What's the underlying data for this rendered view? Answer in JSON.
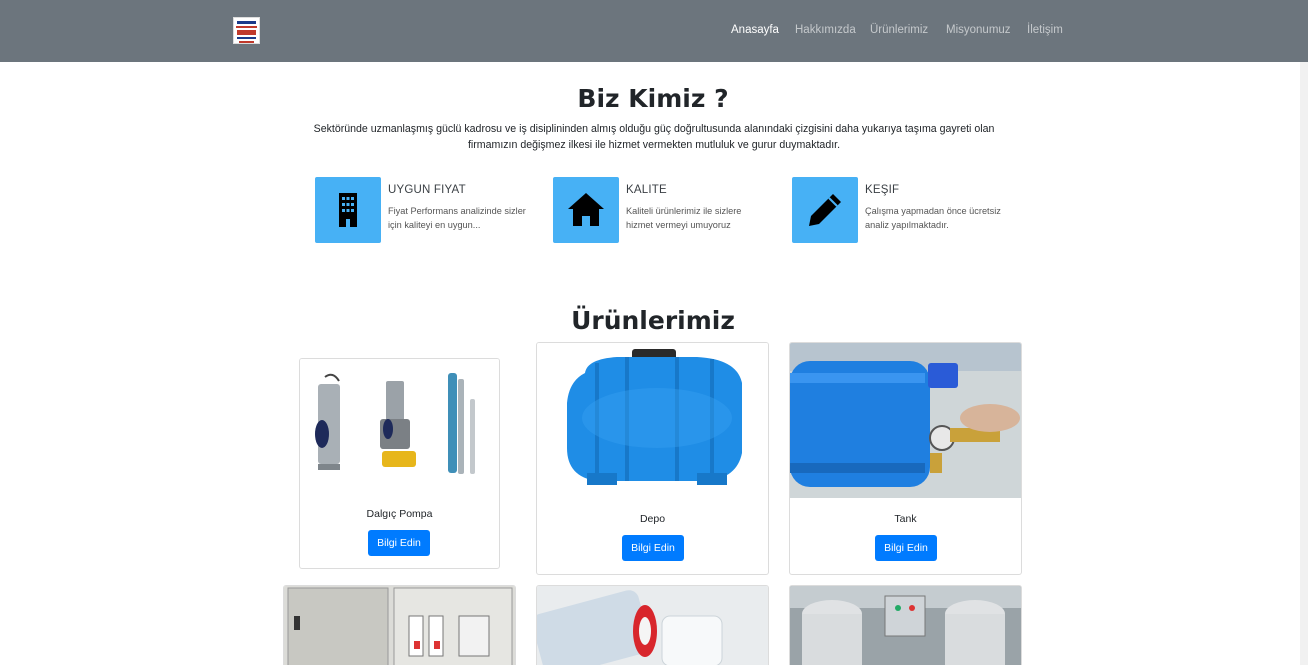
{
  "navbar": {
    "logo_icon": "company-logo",
    "links": [
      "Anasayfa",
      "Hakkımızda",
      "Ürünlerimiz",
      "Misyonumuz",
      "İletişim"
    ],
    "active_index": 0
  },
  "about": {
    "title": "Biz Kimiz ?",
    "text": "Sektöründe uzmanlaşmış güclü kadrosu ve iş disiplininden almış olduğu güç doğrultusunda alanındaki çizgisini daha yukarıya taşıma gayreti olan firmamızın değişmez ilkesi ile hizmet vermekten mutluluk ve gurur duymaktadır.",
    "features": [
      {
        "title": "UYGUN FIYAT",
        "desc": "Fiyat Performans analizinde sizler için kaliteyi en uygun...",
        "icon": "building-icon"
      },
      {
        "title": "KALITE",
        "desc": "Kaliteli ürünlerimiz ile sizlere hizmet vermeyi umuyoruz",
        "icon": "home-icon"
      },
      {
        "title": "KEŞIF",
        "desc": "Çalışma yapmadan önce ücretsiz analiz yapılmaktadır.",
        "icon": "pencil-icon"
      }
    ],
    "accent_color": "#47b1f5"
  },
  "products": {
    "title": "Ürünlerimiz",
    "button_color": "#007bff",
    "items": [
      {
        "name": "Dalgıç Pompa",
        "button": "Bilgi Edin",
        "image": "submersible-pumps-image"
      },
      {
        "name": "Depo",
        "button": "Bilgi Edin",
        "image": "water-tank-image"
      },
      {
        "name": "Tank",
        "button": "Bilgi Edin",
        "image": "pressure-tank-image"
      },
      {
        "image": "electrical-panel-image"
      },
      {
        "image": "filter-cartridge-image"
      },
      {
        "image": "industrial-equipment-image"
      }
    ]
  }
}
